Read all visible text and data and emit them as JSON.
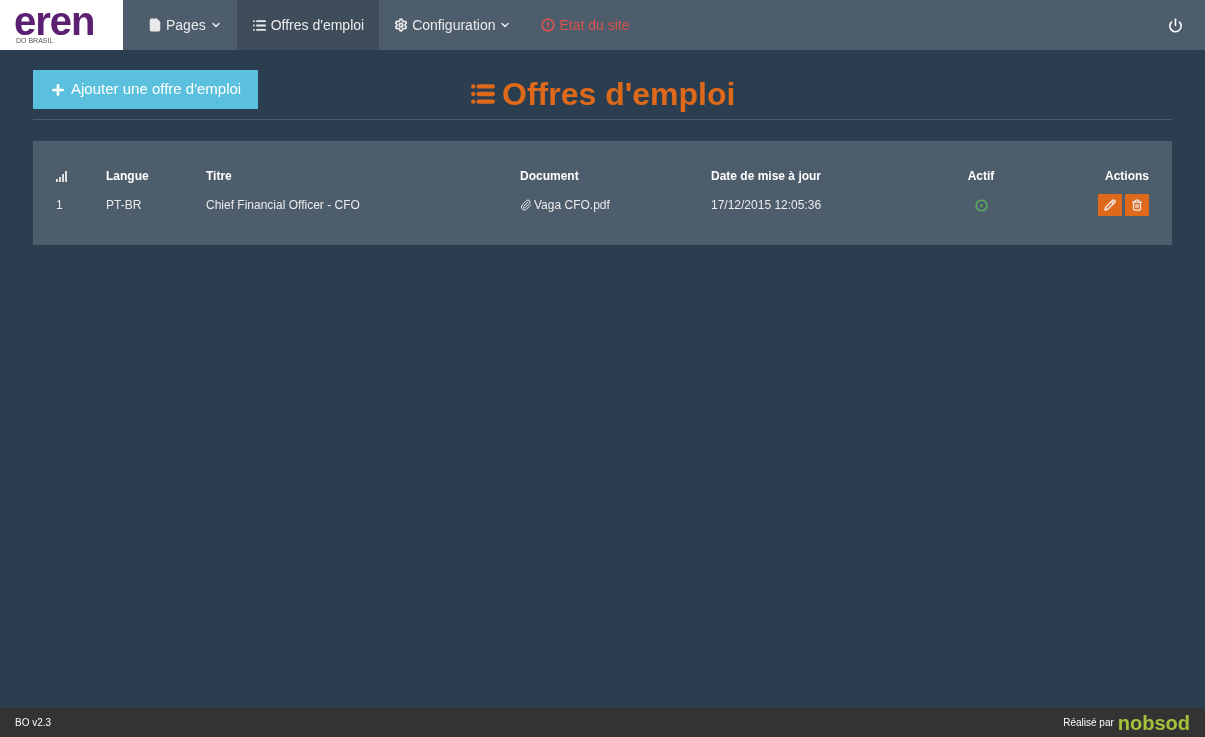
{
  "logo": {
    "name": "eren",
    "subtitle": "DO BRASIL"
  },
  "nav": [
    {
      "label": "Pages",
      "kind": "dropdown",
      "selected": false
    },
    {
      "label": "Offres d'emploi",
      "kind": "list",
      "selected": true
    },
    {
      "label": "Configuration",
      "kind": "settings",
      "selected": false
    },
    {
      "label": "Etat du site",
      "kind": "alert",
      "selected": false
    }
  ],
  "add_button": "Ajouter une offre d'emploi",
  "page_title": "Offres d'emploi",
  "table": {
    "columns": [
      "Langue",
      "Titre",
      "Document",
      "Date de mise à jour",
      "Actif",
      "Actions"
    ],
    "rows": [
      {
        "index": "1",
        "langue": "PT-BR",
        "titre": "Chief Financial Officer - CFO",
        "document": "Vaga CFO.pdf",
        "date": "17/12/2015 12:05:36",
        "active": true
      }
    ]
  },
  "footer": {
    "version": "BO v2.3",
    "credit": "Réalisé par",
    "brand": "nobsod"
  }
}
